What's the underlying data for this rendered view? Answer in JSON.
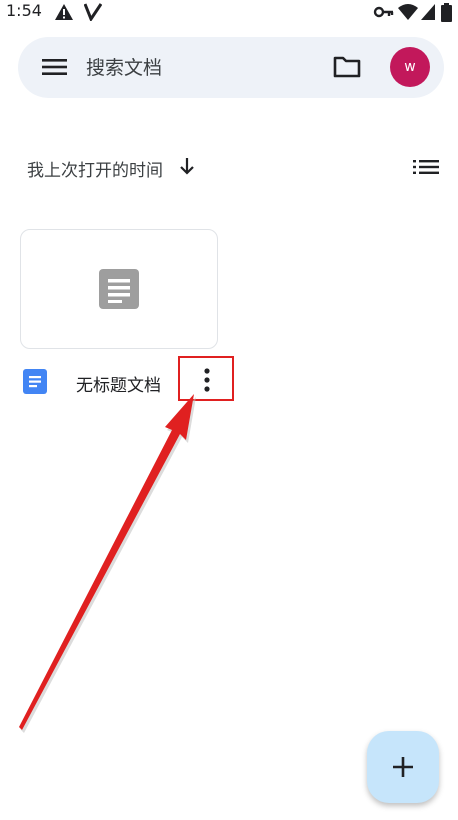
{
  "status_bar": {
    "time": "1:54",
    "left_icons": [
      "warning-icon",
      "signal-v-icon"
    ],
    "right_icons": [
      "key-icon",
      "wifi-icon",
      "signal-icon",
      "battery-icon"
    ]
  },
  "search_bar": {
    "placeholder": "搜索文档",
    "menu_icon": "menu-icon",
    "folder_icon": "folder-icon",
    "avatar_letter": "w",
    "avatar_color": "#c2185b"
  },
  "sort": {
    "label": "我上次打开的时间",
    "direction_icon": "arrow-down-icon",
    "view_icon": "list-view-icon"
  },
  "documents": [
    {
      "title": "无标题文档",
      "app_icon": "google-docs-icon",
      "more_icon": "more-vert-icon"
    }
  ],
  "fab": {
    "icon": "plus-icon",
    "color": "#c6e5fb"
  },
  "annotation": {
    "highlight_color": "#e02020"
  }
}
